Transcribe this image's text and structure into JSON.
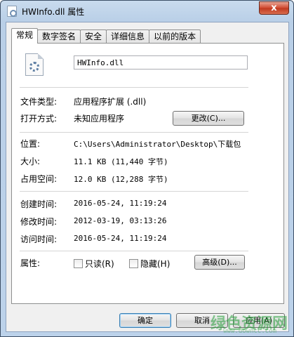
{
  "window": {
    "title": "HWInfo.dll 属性",
    "close_glyph": "x"
  },
  "tabs": [
    {
      "label": "常规",
      "active": true
    },
    {
      "label": "数字签名",
      "active": false
    },
    {
      "label": "安全",
      "active": false
    },
    {
      "label": "详细信息",
      "active": false
    },
    {
      "label": "以前的版本",
      "active": false
    }
  ],
  "general": {
    "file_name": "HWInfo.dll",
    "file_type_label": "文件类型:",
    "file_type_value": "应用程序扩展 (.dll)",
    "opens_with_label": "打开方式:",
    "opens_with_value": "未知应用程序",
    "change_button": "更改(C)...",
    "location_label": "位置:",
    "location_value": "C:\\Users\\Administrator\\Desktop\\下载包",
    "size_label": "大小:",
    "size_value": "11.1 KB (11,440 字节)",
    "size_on_disk_label": "占用空间:",
    "size_on_disk_value": "12.0 KB (12,288 字节)",
    "created_label": "创建时间:",
    "created_value": "2016-05-24, 11:19:24",
    "modified_label": "修改时间:",
    "modified_value": "2012-03-19, 03:13:26",
    "accessed_label": "访问时间:",
    "accessed_value": "2016-05-24, 11:19:24",
    "attributes_label": "属性:",
    "readonly_label": "只读(R)",
    "hidden_label": "隐藏(H)",
    "advanced_button": "高级(D)..."
  },
  "footer": {
    "ok": "确定",
    "cancel": "取消",
    "apply": "应用(A)"
  },
  "watermark": {
    "text": "绿色资源网",
    "url": "www.downcc.com"
  },
  "icons": [
    "dll-file-icon",
    "close-icon"
  ]
}
